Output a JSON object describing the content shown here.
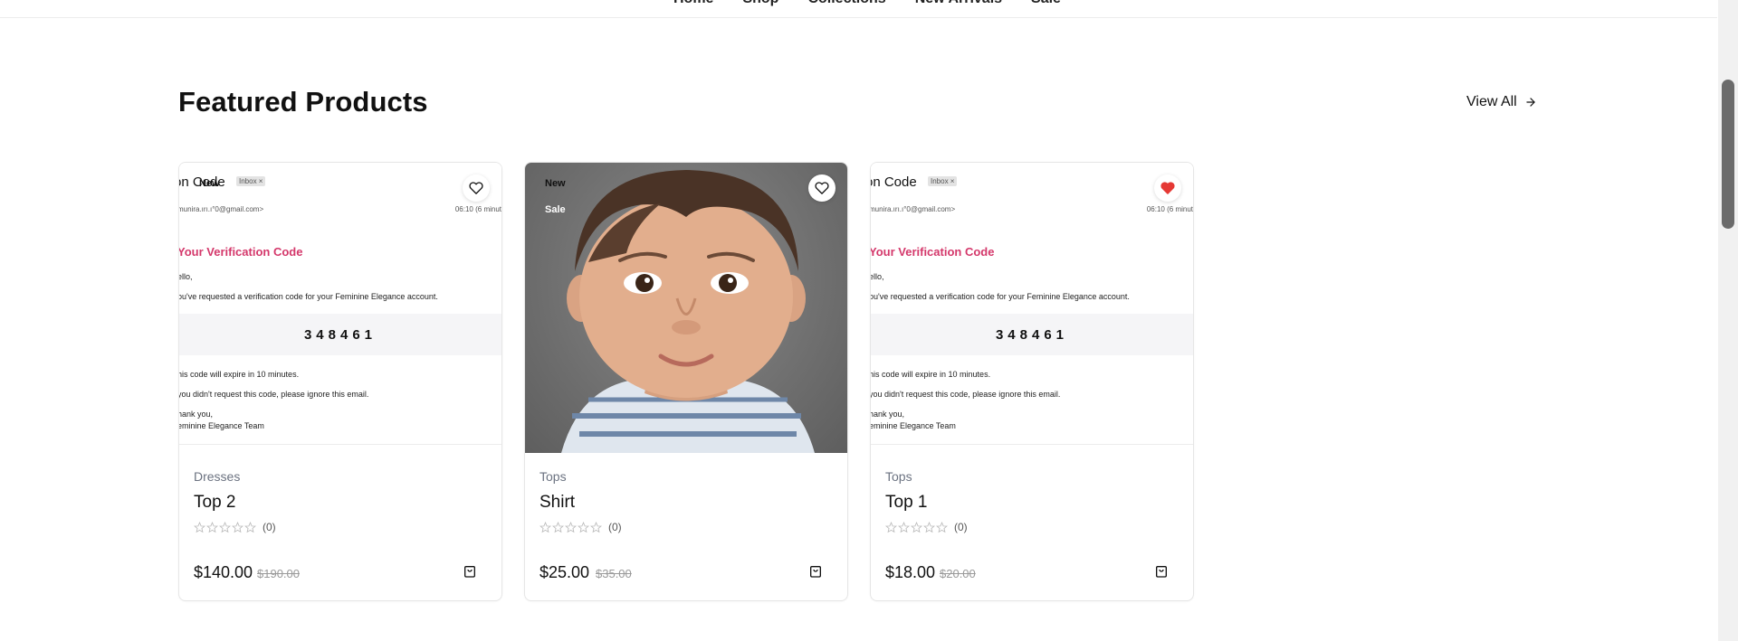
{
  "nav": {
    "links": [
      "Home",
      "Shop",
      "Collections",
      "New Arrivals",
      "Sale"
    ]
  },
  "section": {
    "title": "Featured Products",
    "view_all": "View All"
  },
  "colors": {
    "accent": "#d4386b",
    "favorite_active": "#e53935"
  },
  "products": [
    {
      "category": "Dresses",
      "name": "Top 2",
      "price": "$140.00",
      "old_price": "$190.00",
      "rating_count": "(0)",
      "favorite": false,
      "badges": [
        "New"
      ],
      "image": {
        "subject": "on Code",
        "inbox_tag": "Inbox ×",
        "from": "munira.ırı.ı°0@gmail.com>",
        "time": "06:10 (6 minut",
        "heading": "Your Verification Code",
        "hello": "ello,",
        "requested": "ou've requested a verification code for your Feminine Elegance account.",
        "code": "348461",
        "expire": "his code will expire in 10 minutes.",
        "ignore": " you didn't request this code, please ignore this email.",
        "thank": "hank you,",
        "team": "eminine Elegance Team"
      }
    },
    {
      "category": "Tops",
      "name": "Shirt",
      "price": "$25.00",
      "old_price": "$35.00",
      "rating_count": "(0)",
      "favorite": false,
      "badges": [
        "New",
        "Sale"
      ]
    },
    {
      "category": "Tops",
      "name": "Top 1",
      "price": "$18.00",
      "old_price": "$20.00",
      "rating_count": "(0)",
      "favorite": true,
      "badges": [],
      "image": {
        "subject": "on Code",
        "inbox_tag": "Inbox ×",
        "from": "munira.ırı.ı°0@gmail.com>",
        "time": "06:10 (6 minut",
        "heading": "Your Verification Code",
        "hello": "ello,",
        "requested": "ou've requested a verification code for your Feminine Elegance account.",
        "code": "348461",
        "expire": "his code will expire in 10 minutes.",
        "ignore": " you didn't request this code, please ignore this email.",
        "thank": "hank you,",
        "team": "eminine Elegance Team"
      }
    }
  ]
}
